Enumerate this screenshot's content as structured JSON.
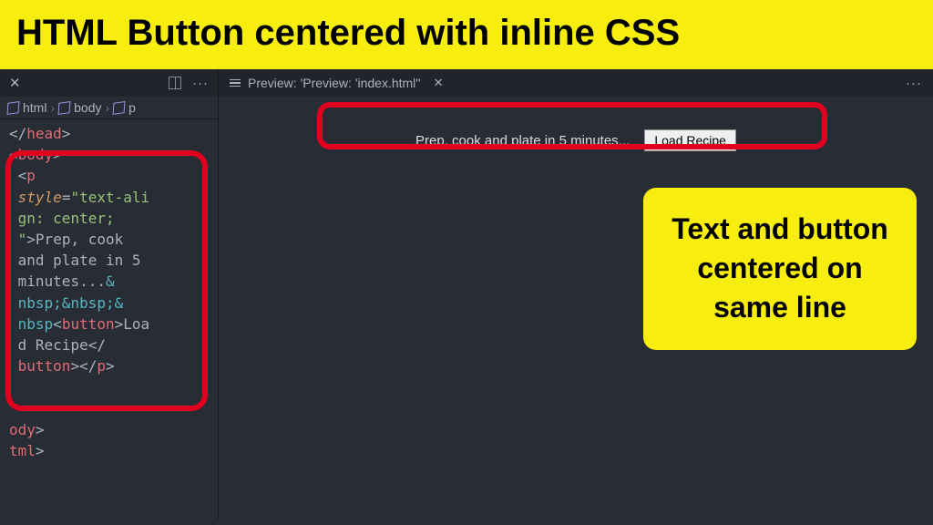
{
  "title": "HTML Button centered with inline CSS",
  "editor": {
    "breadcrumb": [
      "html",
      "body",
      "p"
    ],
    "code": {
      "line1": {
        "punc1": "</",
        "tag": "head",
        "punc2": ">"
      },
      "line2": {
        "punc1": "<",
        "tag": "body",
        "punc2": ">"
      },
      "pOpen": {
        "punc1": "<",
        "tag": "p"
      },
      "attrName": "style",
      "attrValue": "\"text-align: center;\"",
      "text1": "Prep, cook and plate in 5 minutes...",
      "entity": "&nbsp;&nbsp;&nbsp",
      "btnOpen": {
        "punc1": "<",
        "tag": "button",
        "punc2": ">"
      },
      "btnText": "Load Recipe",
      "btnClose": {
        "punc1": "</",
        "tag": "button",
        "punc2": ">"
      },
      "pClose": {
        "punc1": "</",
        "tag": "p",
        "punc2": ">"
      },
      "bodyClose": {
        "tag": "ody",
        "punc": ">"
      },
      "htmlClose": {
        "tag": "tml",
        "punc": ">"
      }
    }
  },
  "preview": {
    "tabLabel": "Preview: 'Preview: 'index.html''",
    "paragraphText": "Prep, cook and plate in 5 minutes...",
    "buttonLabel": "Load Recipe"
  },
  "callout": "Text and button centered on same line"
}
